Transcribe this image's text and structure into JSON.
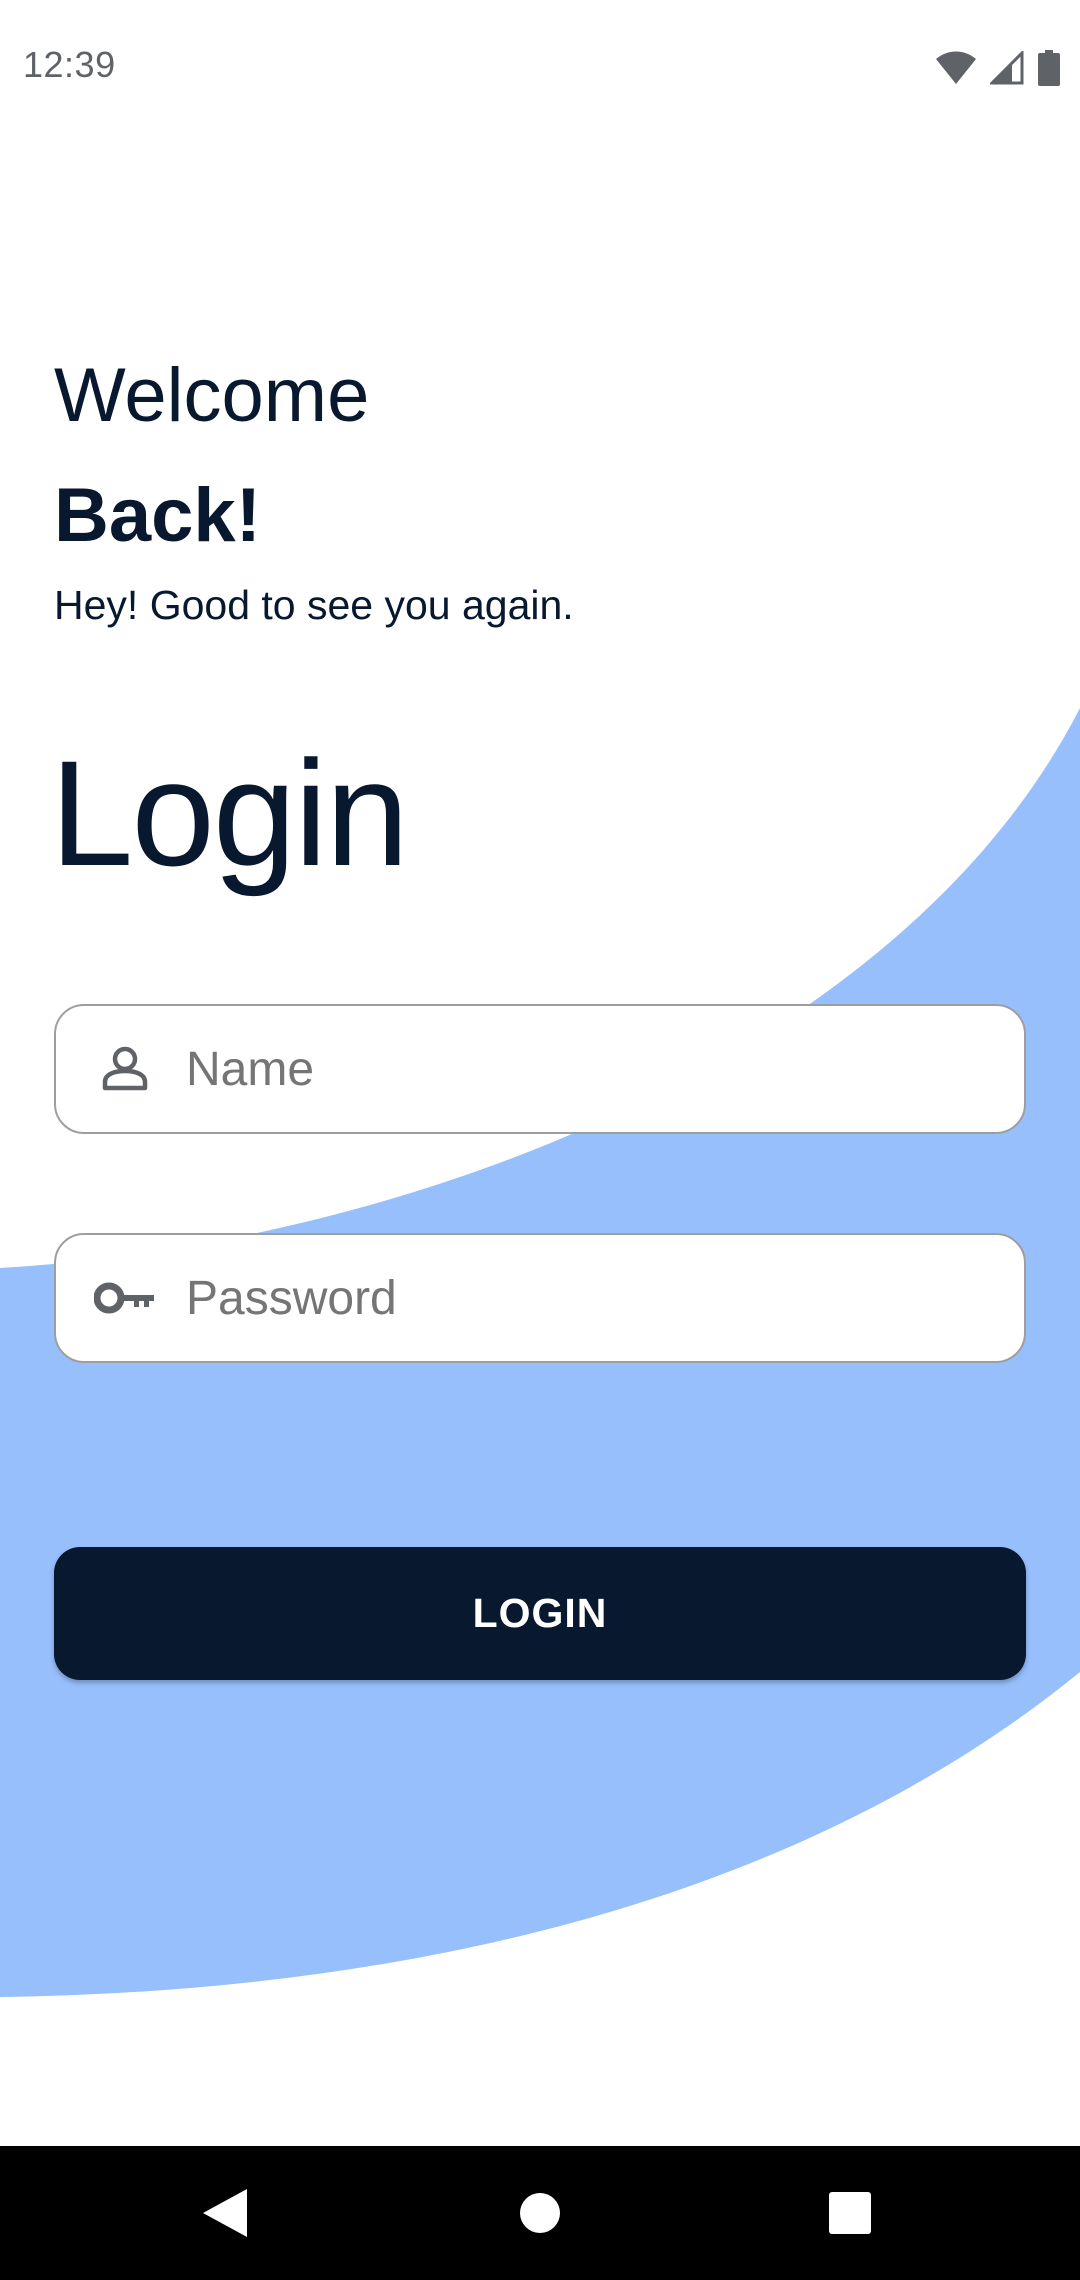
{
  "status_bar": {
    "time": "12:39",
    "icons": [
      "wifi-icon",
      "cell-signal-icon",
      "battery-icon"
    ]
  },
  "header": {
    "welcome": "Welcome",
    "back": "Back!",
    "subtitle": "Hey! Good to see you again."
  },
  "login": {
    "heading": "Login",
    "name_field": {
      "icon": "person-icon",
      "value": "",
      "placeholder": "Name"
    },
    "password_field": {
      "icon": "key-icon",
      "value": "",
      "placeholder": "Password"
    },
    "button_label": "LOGIN"
  },
  "nav_bar": {
    "buttons": [
      "back-icon",
      "home-icon",
      "recents-icon"
    ]
  },
  "colors": {
    "primary_dark": "#07182f",
    "accent_blue": "#97bffc",
    "field_border": "#9e9e9e",
    "placeholder": "#757575",
    "background": "#ffffff"
  }
}
